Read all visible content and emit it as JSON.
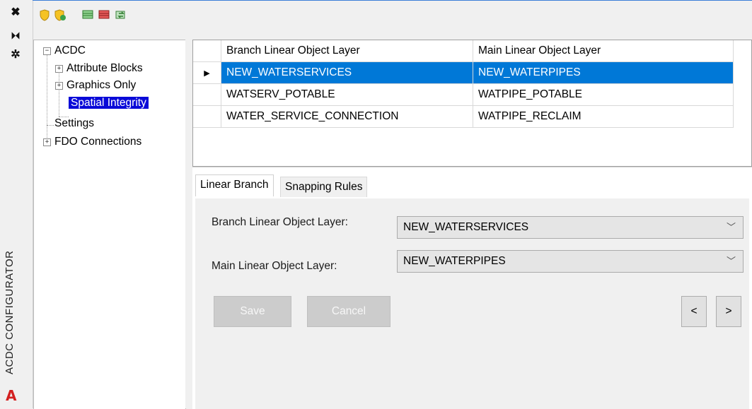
{
  "strip": {
    "icons": [
      "close-icon",
      "pin-icon",
      "settings-icon"
    ],
    "title": "ACDC CONFIGURATOR",
    "logo": "A"
  },
  "toolbar": {
    "icons": [
      "shield-icon",
      "shield-add-icon",
      "layer-add-icon",
      "layer-remove-icon",
      "layer-refresh-icon"
    ]
  },
  "tree": {
    "root": "ACDC",
    "items": [
      {
        "label": "Attribute Blocks",
        "expander": "+"
      },
      {
        "label": "Graphics Only",
        "expander": "+"
      },
      {
        "label": "Spatial Integrity",
        "expander": ""
      },
      {
        "label": "Settings",
        "expander": ""
      },
      {
        "label": "FDO Connections",
        "expander": "+"
      }
    ],
    "root_expander": "−"
  },
  "grid": {
    "columns": [
      "Branch Linear Object Layer",
      "Main Linear Object Layer"
    ],
    "rows": [
      {
        "branch": "NEW_WATERSERVICES",
        "main": "NEW_WATERPIPES",
        "indicator": "▶"
      },
      {
        "branch": "WATSERV_POTABLE",
        "main": "WATPIPE_POTABLE",
        "indicator": ""
      },
      {
        "branch": "WATER_SERVICE_CONNECTION",
        "main": "WATPIPE_RECLAIM",
        "indicator": ""
      }
    ]
  },
  "tabs": {
    "items": [
      "Linear Branch",
      "Snapping Rules"
    ],
    "active": "Linear Branch"
  },
  "form": {
    "branch_label": "Branch Linear Object Layer:",
    "branch_value": "NEW_WATERSERVICES",
    "main_label": "Main Linear Object Layer:",
    "main_value": "NEW_WATERPIPES",
    "chevron": "﹀",
    "save": "Save",
    "cancel": "Cancel",
    "prev": "<",
    "next": ">"
  },
  "colors": {
    "selection_row": "#0078d7",
    "tree_selection": "#0a0ad8",
    "accent_line": "#3b7ed8"
  }
}
